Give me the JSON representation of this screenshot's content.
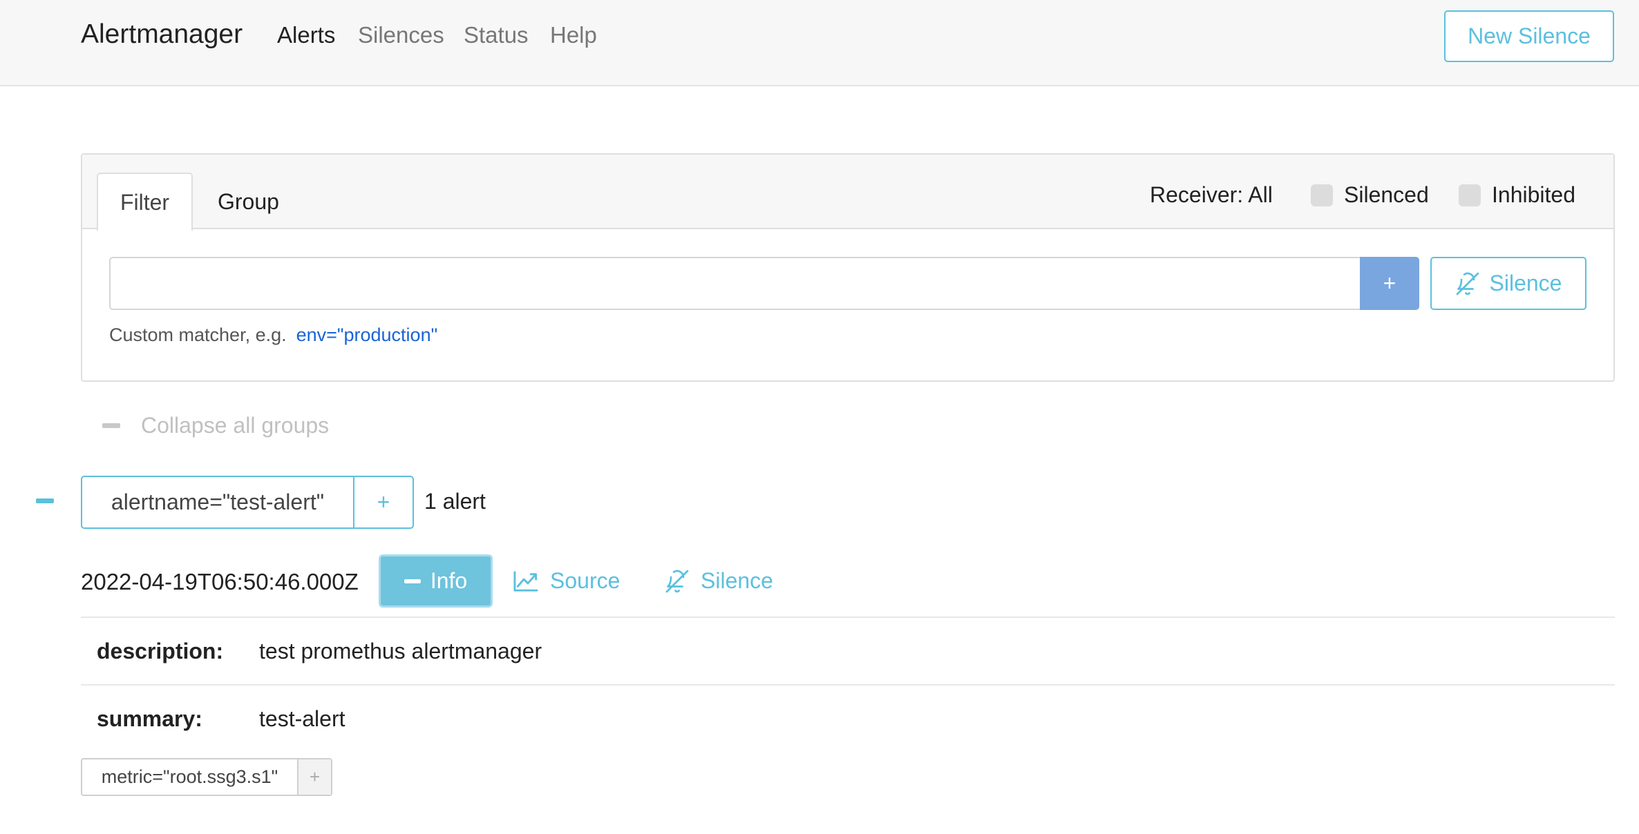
{
  "navbar": {
    "brand": "Alertmanager",
    "links": [
      "Alerts",
      "Silences",
      "Status",
      "Help"
    ],
    "new_silence": "New Silence"
  },
  "filter_card": {
    "tabs": [
      "Filter",
      "Group"
    ],
    "receiver": "Receiver: All",
    "silenced_label": "Silenced",
    "inhibited_label": "Inhibited",
    "input_value": "",
    "add_button": "+",
    "silence_button": "Silence",
    "hint_text": "Custom matcher, e.g.",
    "hint_example": "env=\"production\""
  },
  "collapse_all": "Collapse all groups",
  "group": {
    "label": "alertname=\"test-alert\"",
    "plus": "+",
    "count": "1 alert"
  },
  "alert": {
    "timestamp": "2022-04-19T06:50:46.000Z",
    "info_button": "Info",
    "source_link": "Source",
    "silence_link": "Silence",
    "annotations": [
      {
        "key": "description:",
        "value": "test promethus alertmanager"
      },
      {
        "key": "summary:",
        "value": "test-alert"
      }
    ],
    "label_chip": "metric=\"root.ssg3.s1\"",
    "label_plus": "+"
  },
  "colors": {
    "accent": "#5bc0de",
    "primary_button": "#7aa6e0",
    "link": "#1a64d4"
  },
  "icons": {
    "silence": "bell-slash-icon",
    "source": "chart-line-icon",
    "collapse": "minus-icon"
  }
}
